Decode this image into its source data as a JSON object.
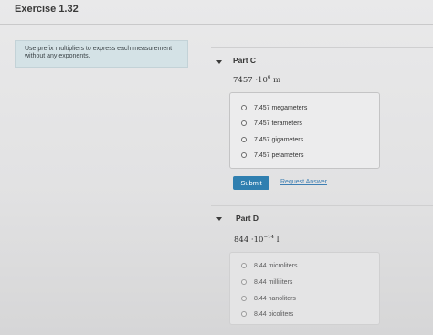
{
  "exercise": {
    "title": "Exercise 1.32"
  },
  "instructions": {
    "text": "Use prefix multipliers to express each measurement without any exponents."
  },
  "part_c": {
    "label": "Part C",
    "expression": {
      "base": "7457 ·10",
      "exponent": "6",
      "unit": "m"
    },
    "options": [
      "7.457 megameters",
      "7.457 terameters",
      "7.457 gigameters",
      "7.457 petameters"
    ],
    "submit_label": "Submit",
    "request_answer_label": "Request Answer"
  },
  "part_d": {
    "label": "Part D",
    "expression": {
      "base": "844 ·10",
      "exponent": "−14",
      "unit": "l"
    },
    "options": [
      "8.44 microliters",
      "8.44 milliliters",
      "8.44 nanoliters",
      "8.44 picoliters"
    ]
  },
  "colors": {
    "background": "#e4e4e5",
    "instruction_box": "#d4e2e6",
    "submit_button": "#2f7fb0",
    "link": "#3f7fb3"
  }
}
